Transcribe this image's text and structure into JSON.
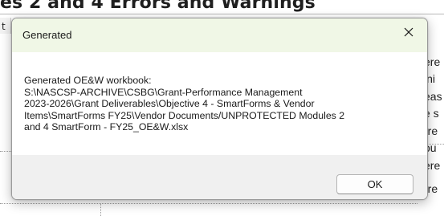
{
  "background": {
    "heading_fragment": "es 2 and 4 Errors and Warnings",
    "left_fragment": "t",
    "right_fragments": [
      "ere",
      "ini",
      "eas",
      "e s",
      "rre",
      "ou",
      "ere",
      "rre"
    ]
  },
  "dialog": {
    "title": "Generated",
    "close_symbol": "✕",
    "message_lines": [
      "Generated OE&W workbook:",
      "S:\\NASCSP-ARCHIVE\\CSBG\\Grant-Performance Management",
      "2023-2026\\Grant Deliverables\\Objective 4 - SmartForms & Vendor",
      "Items\\SmartForms FY25\\Vendor Documents/UNPROTECTED Modules 2",
      "and 4 SmartForm - FY25_OE&W.xlsx"
    ],
    "ok_label": "OK"
  },
  "colors": {
    "titlebar_bg": "#f0f7e6",
    "footer_bg": "#f0f0f0",
    "button_border": "#b4b4b4"
  },
  "icons": {
    "close": "close-icon"
  }
}
